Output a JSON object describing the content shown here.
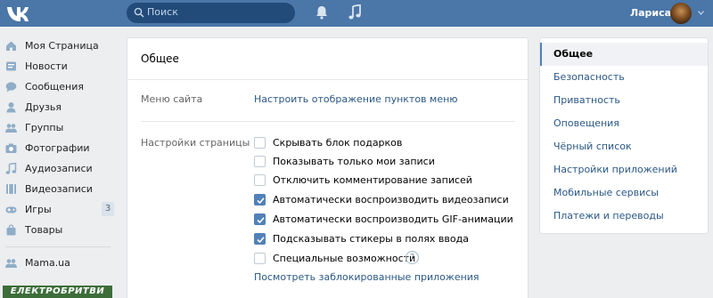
{
  "header": {
    "logo_icon": "vk-logo-icon",
    "search_placeholder": "Поиск",
    "user_name": "Лариса",
    "accent": "#4a76a8"
  },
  "nav": {
    "items": [
      {
        "label": "Моя Страница",
        "icon": "home-icon"
      },
      {
        "label": "Новости",
        "icon": "news-icon"
      },
      {
        "label": "Сообщения",
        "icon": "messages-icon"
      },
      {
        "label": "Друзья",
        "icon": "friends-icon"
      },
      {
        "label": "Группы",
        "icon": "groups-icon"
      },
      {
        "label": "Фотографии",
        "icon": "camera-icon"
      },
      {
        "label": "Аудиозаписи",
        "icon": "music-icon"
      },
      {
        "label": "Видеозаписи",
        "icon": "video-icon"
      },
      {
        "label": "Игры",
        "icon": "gamepad-icon",
        "badge": "3"
      },
      {
        "label": "Товары",
        "icon": "bag-icon"
      }
    ],
    "apps": [
      {
        "label": "Mama.ua",
        "icon": "people-icon"
      }
    ],
    "promo": "ЕЛЕКТРОБРИТВИ"
  },
  "main": {
    "title": "Общее",
    "menu_label": "Меню сайта",
    "menu_link": "Настроить отображение пунктов меню",
    "page_settings_label": "Настройки страницы",
    "options": [
      {
        "label": "Скрывать блок подарков",
        "checked": false
      },
      {
        "label": "Показывать только мои записи",
        "checked": false
      },
      {
        "label": "Отключить комментирование записей",
        "checked": false
      },
      {
        "label": "Автоматически воспроизводить видеозаписи",
        "checked": true
      },
      {
        "label": "Автоматически воспроизводить GIF-анимации",
        "checked": true
      },
      {
        "label": "Подсказывать стикеры в полях ввода",
        "checked": true
      },
      {
        "label": "Специальные возможности",
        "checked": false
      }
    ],
    "help_mark": "?",
    "blocked_apps_link": "Посмотреть заблокированные приложения"
  },
  "settings_nav": {
    "items": [
      {
        "label": "Общее",
        "active": true
      },
      {
        "label": "Безопасность"
      },
      {
        "label": "Приватность"
      },
      {
        "label": "Оповещения"
      },
      {
        "label": "Чёрный список"
      },
      {
        "label": "Настройки приложений"
      },
      {
        "label": "Мобильные сервисы"
      },
      {
        "label": "Платежи и переводы"
      }
    ]
  }
}
